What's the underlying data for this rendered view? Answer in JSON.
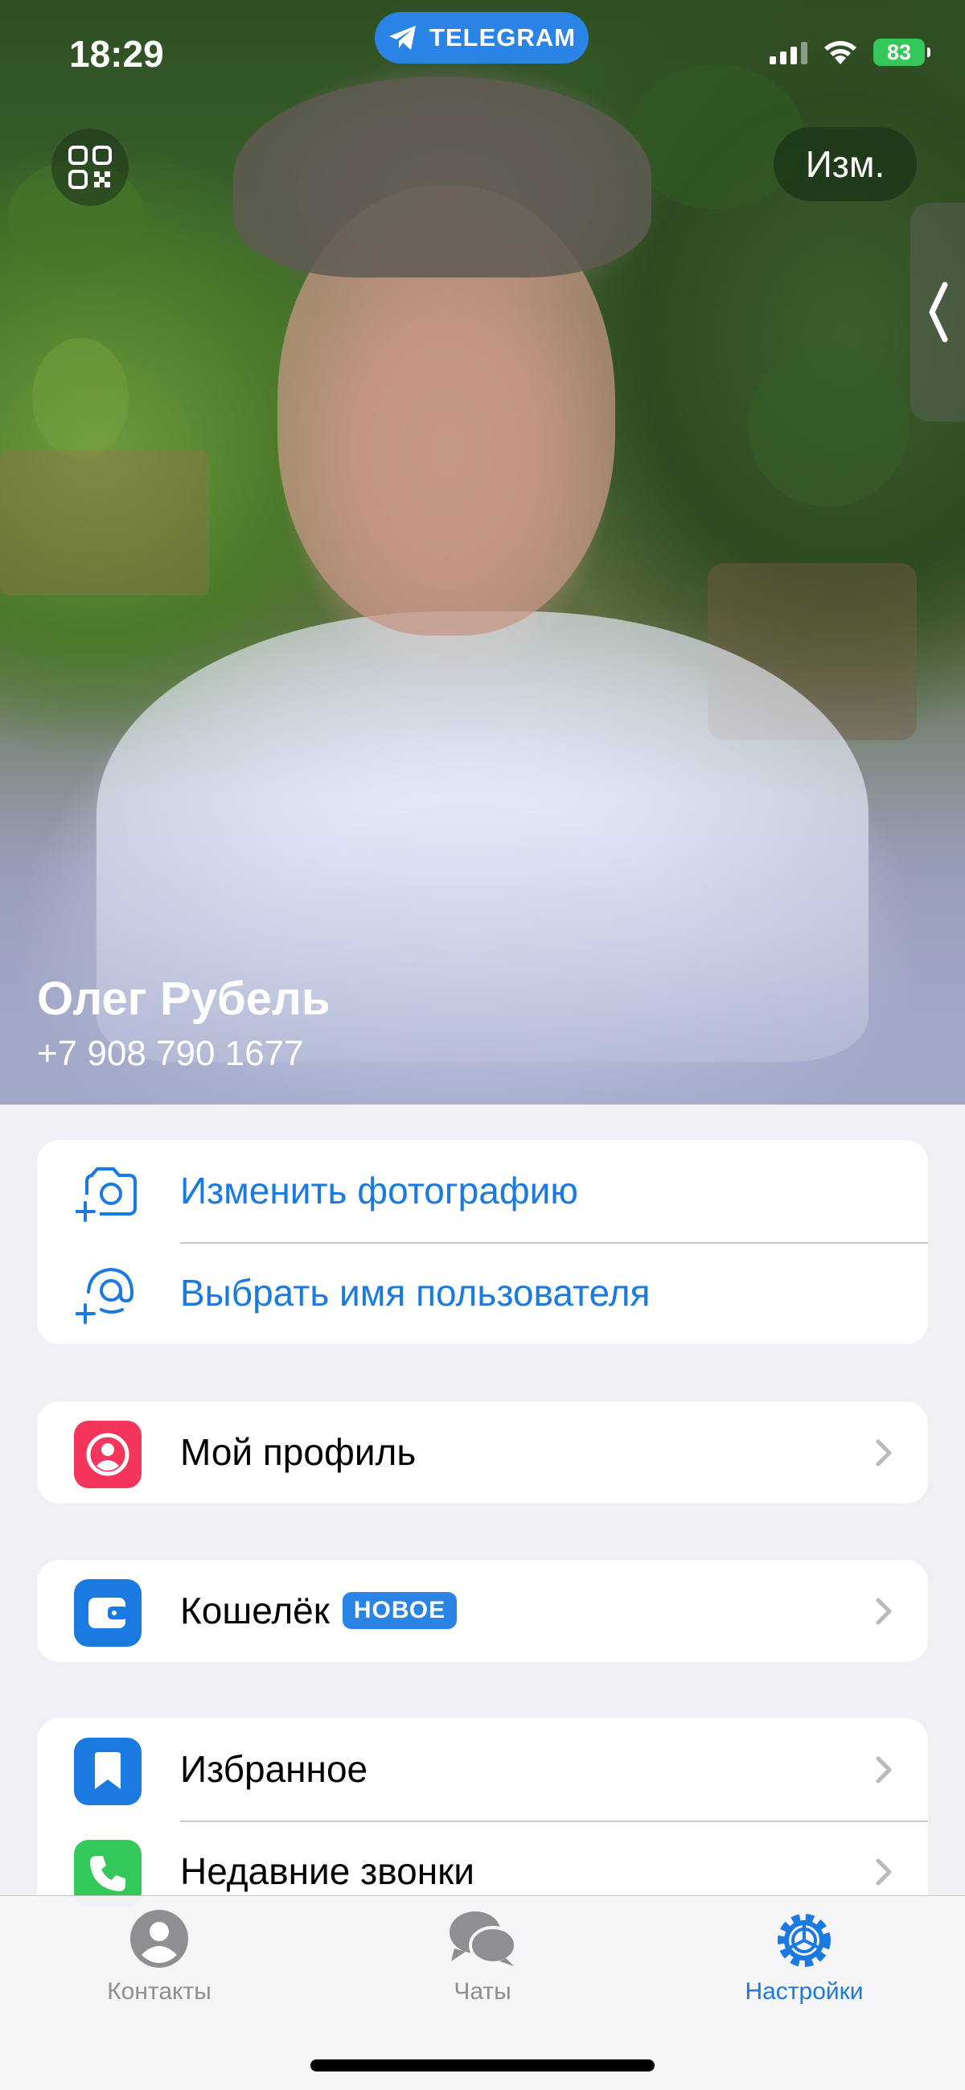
{
  "status": {
    "time": "18:29",
    "app_pill": "TELEGRAM",
    "battery": "83"
  },
  "header": {
    "edit_label": "Изм."
  },
  "profile": {
    "name": "Олег Рубель",
    "phone": "+7 908 790 1677"
  },
  "photo_actions": [
    {
      "label": "Изменить фотографию",
      "icon": "camera-add-icon"
    },
    {
      "label": "Выбрать имя пользователя",
      "icon": "at-add-icon"
    }
  ],
  "menu": {
    "my_profile": {
      "label": "Мой профиль",
      "icon": "person-icon",
      "color": "#f5365c"
    },
    "wallet": {
      "label": "Кошелёк",
      "badge": "НОВОЕ",
      "icon": "wallet-icon",
      "color": "#1b7ae0"
    },
    "favorites": {
      "label": "Избранное",
      "icon": "bookmark-icon",
      "color": "#1b7ae0"
    },
    "recent_calls": {
      "label": "Недавние звонки",
      "icon": "phone-icon",
      "color": "#34c759"
    }
  },
  "tabs": [
    {
      "label": "Контакты",
      "icon": "person-circle-icon",
      "active": false
    },
    {
      "label": "Чаты",
      "icon": "chat-bubbles-icon",
      "active": false
    },
    {
      "label": "Настройки",
      "icon": "gear-icon",
      "active": true
    }
  ],
  "colors": {
    "accent": "#1b7ae0",
    "background": "#efeff4",
    "inactive": "#8e8e93"
  }
}
